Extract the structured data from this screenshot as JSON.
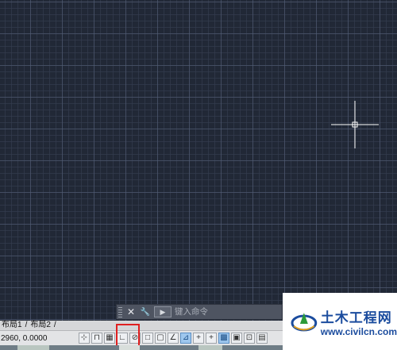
{
  "layout_tabs": [
    "布局1",
    "布局2"
  ],
  "tab_separator": "/",
  "status": {
    "coordinates": "2960, 0.0000"
  },
  "command_line": {
    "close_glyph": "✕",
    "wrench_glyph": "🔧",
    "prompt_glyph": "▶",
    "placeholder": "键入命令"
  },
  "status_toolbar": [
    {
      "name": "snap-mode-icon",
      "glyph": "⊹",
      "on": false
    },
    {
      "name": "infer-icon",
      "glyph": "⊓",
      "on": false
    },
    {
      "name": "grid-display-icon",
      "glyph": "▦",
      "on": false
    },
    {
      "name": "ortho-mode-icon",
      "glyph": "∟",
      "on": false
    },
    {
      "name": "polar-tracking-icon",
      "glyph": "⊘",
      "on": false
    },
    {
      "name": "osnap-icon",
      "glyph": "□",
      "on": false
    },
    {
      "name": "3d-osnap-icon",
      "glyph": "▢",
      "on": false
    },
    {
      "name": "object-tracking-icon",
      "glyph": "∠",
      "on": false
    },
    {
      "name": "dynamic-ucs-icon",
      "glyph": "⊿",
      "on": true
    },
    {
      "name": "dynamic-input-icon",
      "glyph": "+",
      "on": false
    },
    {
      "name": "lineweight-icon",
      "glyph": "+",
      "on": false
    },
    {
      "name": "transparency-icon",
      "glyph": "▩",
      "on": true
    },
    {
      "name": "quick-properties-icon",
      "glyph": "▣",
      "on": false
    },
    {
      "name": "selection-cycling-icon",
      "glyph": "⊡",
      "on": false
    },
    {
      "name": "annotation-monitor-icon",
      "glyph": "▤",
      "on": false
    }
  ],
  "watermark": {
    "text_cn": "土木工程网",
    "text_en": "www.civilcn.com"
  },
  "colors": {
    "canvas": "#212836",
    "highlight": "#e02020",
    "logo_blue": "#1b4c9e"
  }
}
